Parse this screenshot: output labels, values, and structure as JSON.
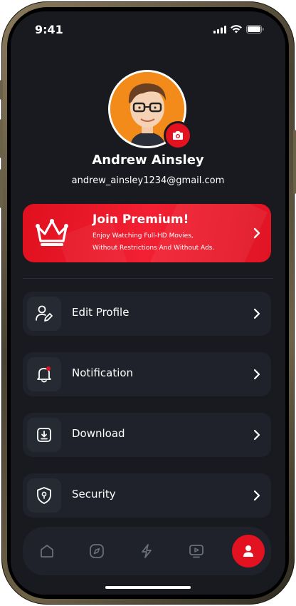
{
  "status_bar": {
    "time": "9:41"
  },
  "profile": {
    "name": "Andrew Ainsley",
    "email": "andrew_ainsley1234@gmail.com"
  },
  "premium": {
    "title": "Join Premium!",
    "description_line1": "Enjoy Watching Full-HD Movies,",
    "description_line2": "Without Restrictions And Without Ads."
  },
  "menu": {
    "items": [
      {
        "label": "Edit Profile",
        "icon": "user-edit-icon"
      },
      {
        "label": "Notification",
        "icon": "bell-icon"
      },
      {
        "label": "Download",
        "icon": "download-icon"
      },
      {
        "label": "Security",
        "icon": "shield-icon"
      }
    ]
  },
  "bottom_nav": {
    "items": [
      "home-icon",
      "explore-icon",
      "lightning-icon",
      "video-icon",
      "profile-icon"
    ],
    "active": "profile-icon"
  },
  "colors": {
    "accent": "#e21221",
    "background": "#181a20",
    "card": "#1f222a"
  }
}
